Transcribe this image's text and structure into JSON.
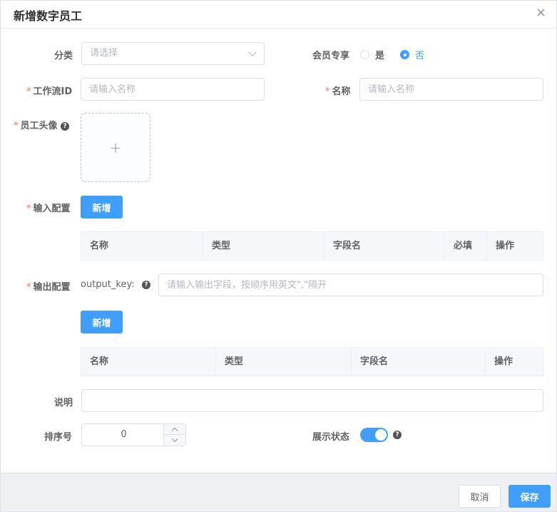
{
  "dialog": {
    "title": "新增数字员工",
    "close_symbol": "×"
  },
  "form": {
    "category": {
      "label": "分类",
      "placeholder": "请选择"
    },
    "member_only": {
      "label": "会员专享",
      "options": [
        "是",
        "否"
      ],
      "selected": "否"
    },
    "workflow_id": {
      "required": "*",
      "label": "工作流ID",
      "placeholder": "请输入名称"
    },
    "name": {
      "required": "*",
      "label": "名称",
      "placeholder": "请输入名称"
    },
    "avatar": {
      "required": "*",
      "label": "员工头像",
      "help": "?",
      "plus": "+"
    },
    "input_config": {
      "required": "*",
      "label": "输入配置",
      "add_label": "新增",
      "columns": [
        "名称",
        "类型",
        "字段名",
        "必填",
        "操作"
      ]
    },
    "output_config": {
      "required": "*",
      "label": "输出配置",
      "key_label": "output_key:",
      "help": "?",
      "placeholder": "请输入输出字段，按顺序用英文\",\"隔开",
      "add_label": "新增",
      "columns": [
        "名称",
        "类型",
        "字段名",
        "操作"
      ]
    },
    "description": {
      "label": "说明",
      "value": ""
    },
    "sort": {
      "label": "排序号",
      "value": "0"
    },
    "display_status": {
      "label": "展示状态",
      "enabled": true,
      "help": "?"
    }
  },
  "footer": {
    "cancel_label": "取消",
    "save_label": "保存"
  },
  "colors": {
    "primary": "#409eff",
    "required": "#f56c6c"
  }
}
